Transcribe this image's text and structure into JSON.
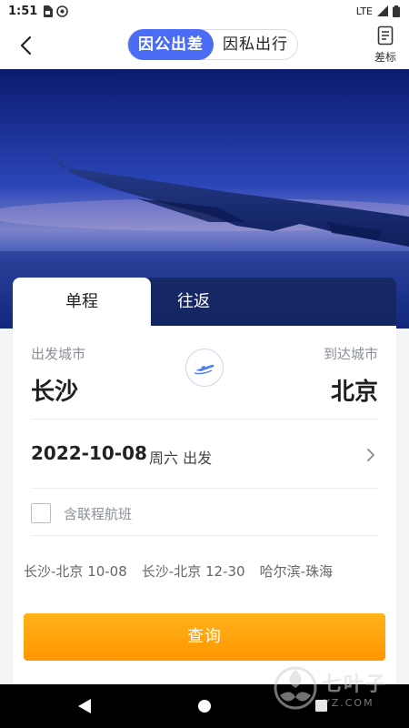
{
  "status_bar": {
    "time": "1:51",
    "network": "LTE"
  },
  "header": {
    "trip_type_active": "因公出差",
    "trip_type_inactive": "因私出行",
    "standard_label": "差标"
  },
  "tabs": {
    "one_way": "单程",
    "round_trip": "往返"
  },
  "search": {
    "from_label": "出发城市",
    "from_city": "长沙",
    "to_label": "到达城市",
    "to_city": "北京",
    "date": "2022-10-08",
    "date_suffix": "周六 出发",
    "connecting_label": "含联程航班"
  },
  "history": [
    "长沙-北京 10-08",
    "长沙-北京 12-30",
    "哈尔滨-珠海"
  ],
  "query_button": "查询",
  "watermark": {
    "title": "七叶子",
    "sub": "YZ.COM"
  },
  "colors": {
    "accent": "#4b6cf5",
    "query_button": "#ff9f0a"
  }
}
